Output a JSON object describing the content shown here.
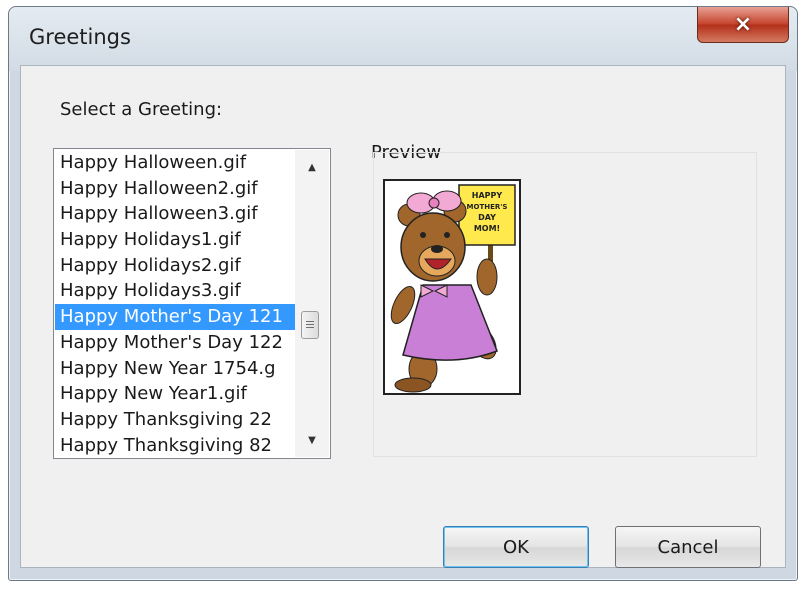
{
  "window": {
    "title": "Greetings",
    "close_glyph": "×"
  },
  "prompt": "Select a Greeting:",
  "list": {
    "items": [
      "Happy Halloween.gif",
      "Happy Halloween2.gif",
      "Happy Halloween3.gif",
      "Happy Holidays1.gif",
      "Happy Holidays2.gif",
      "Happy Holidays3.gif",
      "Happy Mother's Day 121",
      "Happy Mother's Day 122",
      "Happy New Year 1754.g",
      "Happy New Year1.gif",
      "Happy Thanksgiving 22",
      "Happy Thanksgiving 82"
    ],
    "selected_index": 6,
    "scroll_up_glyph": "▲",
    "scroll_down_glyph": "▼"
  },
  "preview": {
    "label": "Preview",
    "sign_text": "HAPPY MOTHER'S DAY MOM!"
  },
  "buttons": {
    "ok": "OK",
    "cancel": "Cancel"
  },
  "colors": {
    "selection": "#3399ff",
    "close_button": "#c5452f",
    "bear_dress": "#c97fd6",
    "bear_fur": "#a0662b",
    "sign": "#ffe94d",
    "bow": "#f2a9d4"
  }
}
